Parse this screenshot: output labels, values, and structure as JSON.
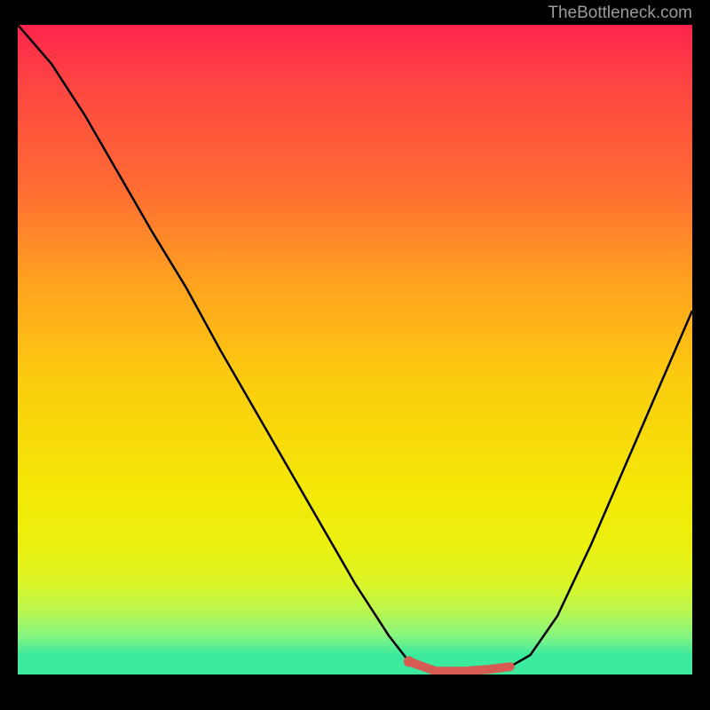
{
  "attribution": "TheBottleneck.com",
  "colors": {
    "top": "#fe234d",
    "bottom": "#3cea9e",
    "curve": "#000000",
    "marker": "#d55b53"
  },
  "chart_data": {
    "type": "line",
    "title": "",
    "xlabel": "",
    "ylabel": "",
    "xlim": [
      0,
      100
    ],
    "ylim": [
      0,
      100
    ],
    "series": [
      {
        "name": "bottleneck-curve",
        "x": [
          0,
          5,
          10,
          15,
          20,
          25,
          30,
          35,
          40,
          45,
          50,
          55,
          58,
          62,
          66,
          70,
          73,
          76,
          80,
          85,
          90,
          95,
          100
        ],
        "y": [
          100,
          94,
          86,
          77,
          68,
          59.5,
          50,
          41,
          32,
          23,
          14,
          6,
          2,
          0.5,
          0.5,
          0.8,
          1.2,
          3,
          9,
          20,
          32,
          44,
          56
        ]
      },
      {
        "name": "optimal-range-marker",
        "x": [
          58,
          62,
          66,
          70,
          73
        ],
        "y": [
          2,
          0.5,
          0.5,
          0.8,
          1.2
        ]
      }
    ]
  }
}
